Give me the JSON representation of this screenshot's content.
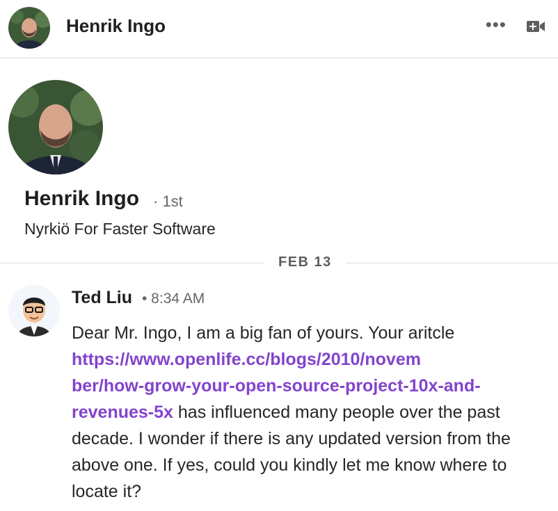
{
  "header": {
    "name": "Henrik Ingo",
    "more_label": "•••",
    "icons": {
      "more": "more-horizontal-icon",
      "video": "video-call-icon"
    }
  },
  "profile": {
    "name": "Henrik Ingo",
    "degree": "· 1st",
    "headline": "Nyrkiö For Faster Software"
  },
  "conversation": {
    "date_label": "FEB 13",
    "messages": [
      {
        "sender": "Ted Liu",
        "time": "• 8:34 AM",
        "text_before": "Dear Mr. Ingo, I am a big fan of yours. Your aritcle ",
        "line_lines": [
          "https://www.openlife.cc/blogs/2010/novem",
          "ber/how-grow-your-open-source-project-10x-and-",
          "revenues-5x"
        ],
        "link": "https://www.openlife.cc/blogs/2010/november/how-grow-your-open-source-project-10x-and-revenues-5x",
        "text_after": " has influenced many people over the past decade. I wonder if there is any updated version from the above one. If yes, could you kindly let me know where to locate it?"
      }
    ]
  },
  "colors": {
    "link": "#8344cc",
    "divider": "#e0e0e0",
    "muted": "#666666"
  }
}
